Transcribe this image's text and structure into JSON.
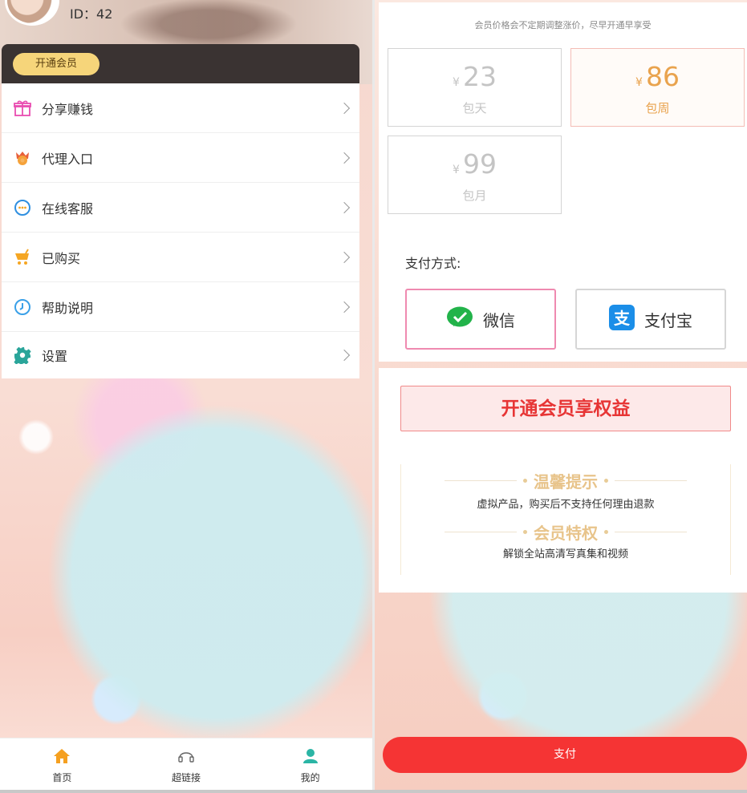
{
  "left": {
    "user": {
      "id_label": "ID：42"
    },
    "vip_pill": "开通会员",
    "menu": [
      {
        "label": "分享赚钱",
        "icon": "gift-icon",
        "color": "#e94db1"
      },
      {
        "label": "代理入口",
        "icon": "agent-badge-icon",
        "color": "#f08a2a"
      },
      {
        "label": "在线客服",
        "icon": "chat-bubble-icon",
        "color": "#2f8fe0"
      },
      {
        "label": "已购买",
        "icon": "cart-icon",
        "color": "#f5a623"
      },
      {
        "label": "帮助说明",
        "icon": "help-clock-icon",
        "color": "#3aa0e8"
      },
      {
        "label": "设置",
        "icon": "gear-icon",
        "color": "#2aa59a"
      }
    ],
    "tabs": [
      {
        "label": "首页",
        "icon": "home-icon",
        "color": "#f5a020"
      },
      {
        "label": "超链接",
        "icon": "headset-icon",
        "color": "#666666"
      },
      {
        "label": "我的",
        "icon": "user-icon",
        "color": "#2bb5a5"
      }
    ]
  },
  "right": {
    "notice": "会员价格会不定期调整涨价，尽早开通早享受",
    "plans": [
      {
        "currency": "¥",
        "price": "23",
        "name": "包天",
        "selected": false
      },
      {
        "currency": "¥",
        "price": "86",
        "name": "包周",
        "selected": true
      },
      {
        "currency": "¥",
        "price": "99",
        "name": "包月",
        "selected": false
      }
    ],
    "pay_title": "支付方式:",
    "pay_methods": [
      {
        "label": "微信",
        "icon": "wechat-icon",
        "selected": true
      },
      {
        "label": "支付宝",
        "icon": "alipay-icon",
        "selected": false
      }
    ],
    "open_vip_button": "开通会员享权益",
    "tips": [
      {
        "heading": "温馨提示",
        "text": "虚拟产品，购买后不支持任何理由退款"
      },
      {
        "heading": "会员特权",
        "text": "解锁全站高清写真集和视频"
      }
    ],
    "submit": "支付"
  },
  "colors": {
    "accent_red": "#f53434",
    "gold": "#e8c48b",
    "selected_price": "#e9a34e"
  }
}
